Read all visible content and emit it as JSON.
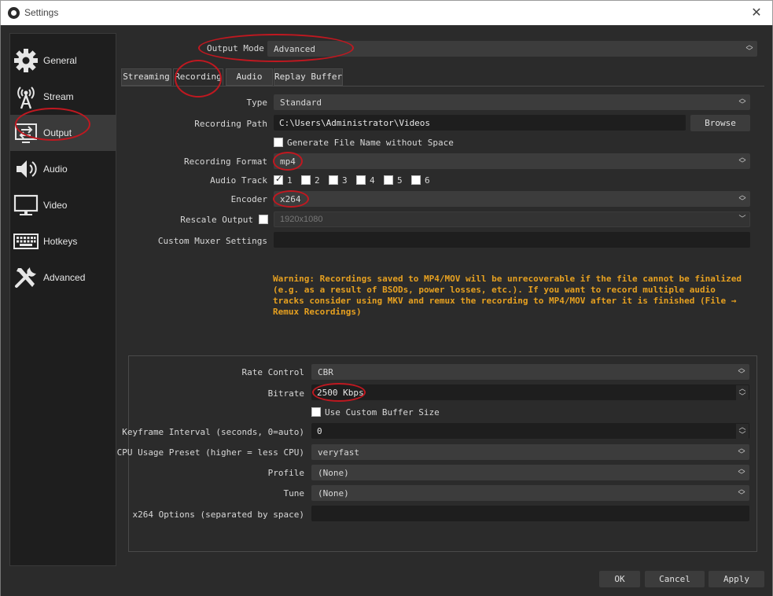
{
  "window": {
    "title": "Settings",
    "close_glyph": "✕"
  },
  "sidebar": {
    "items": [
      {
        "label": "General",
        "icon": "gear-icon"
      },
      {
        "label": "Stream",
        "icon": "antenna-icon"
      },
      {
        "label": "Output",
        "icon": "output-icon",
        "active": true
      },
      {
        "label": "Audio",
        "icon": "speaker-icon"
      },
      {
        "label": "Video",
        "icon": "monitor-icon"
      },
      {
        "label": "Hotkeys",
        "icon": "keyboard-icon"
      },
      {
        "label": "Advanced",
        "icon": "tools-icon"
      }
    ]
  },
  "output_mode": {
    "label": "Output Mode",
    "value": "Advanced"
  },
  "tabs": [
    {
      "label": "Streaming"
    },
    {
      "label": "Recording",
      "active": true
    },
    {
      "label": "Audio"
    },
    {
      "label": "Replay Buffer"
    }
  ],
  "recording": {
    "type": {
      "label": "Type",
      "value": "Standard"
    },
    "path": {
      "label": "Recording Path",
      "value": "C:\\Users\\Administrator\\Videos",
      "browse_label": "Browse"
    },
    "generate_no_space": {
      "label": "Generate File Name without Space",
      "checked": false
    },
    "format": {
      "label": "Recording Format",
      "value": "mp4"
    },
    "audio_track": {
      "label": "Audio Track",
      "tracks": [
        "1",
        "2",
        "3",
        "4",
        "5",
        "6"
      ],
      "checked": [
        true,
        false,
        false,
        false,
        false,
        false
      ]
    },
    "encoder": {
      "label": "Encoder",
      "value": "x264"
    },
    "rescale": {
      "label": "Rescale Output",
      "value": "1920x1080",
      "checked": false
    },
    "muxer": {
      "label": "Custom Muxer Settings",
      "value": ""
    },
    "warning": "Warning: Recordings saved to MP4/MOV will be unrecoverable if the file cannot be finalized (e.g. as a result of BSODs, power losses, etc.). If you want to record multiple audio tracks consider using MKV and remux the recording to MP4/MOV after it is finished (File → Remux Recordings)"
  },
  "encoder_settings": {
    "rate_control": {
      "label": "Rate Control",
      "value": "CBR"
    },
    "bitrate": {
      "label": "Bitrate",
      "value": "2500 Kbps"
    },
    "custom_buffer": {
      "label": "Use Custom Buffer Size",
      "checked": false
    },
    "keyframe": {
      "label": "Keyframe Interval (seconds, 0=auto)",
      "value": "0"
    },
    "cpu_preset": {
      "label": "CPU Usage Preset (higher = less CPU)",
      "value": "veryfast"
    },
    "profile": {
      "label": "Profile",
      "value": "(None)"
    },
    "tune": {
      "label": "Tune",
      "value": "(None)"
    },
    "x264_options": {
      "label": "x264 Options (separated by space)",
      "value": ""
    }
  },
  "footer": {
    "ok_label": "OK",
    "cancel_label": "Cancel",
    "apply_label": "Apply"
  },
  "colors": {
    "annotation": "#c01820",
    "warning": "#e6a020",
    "background": "#2b2b2b",
    "sidebar": "#1e1e1e"
  }
}
